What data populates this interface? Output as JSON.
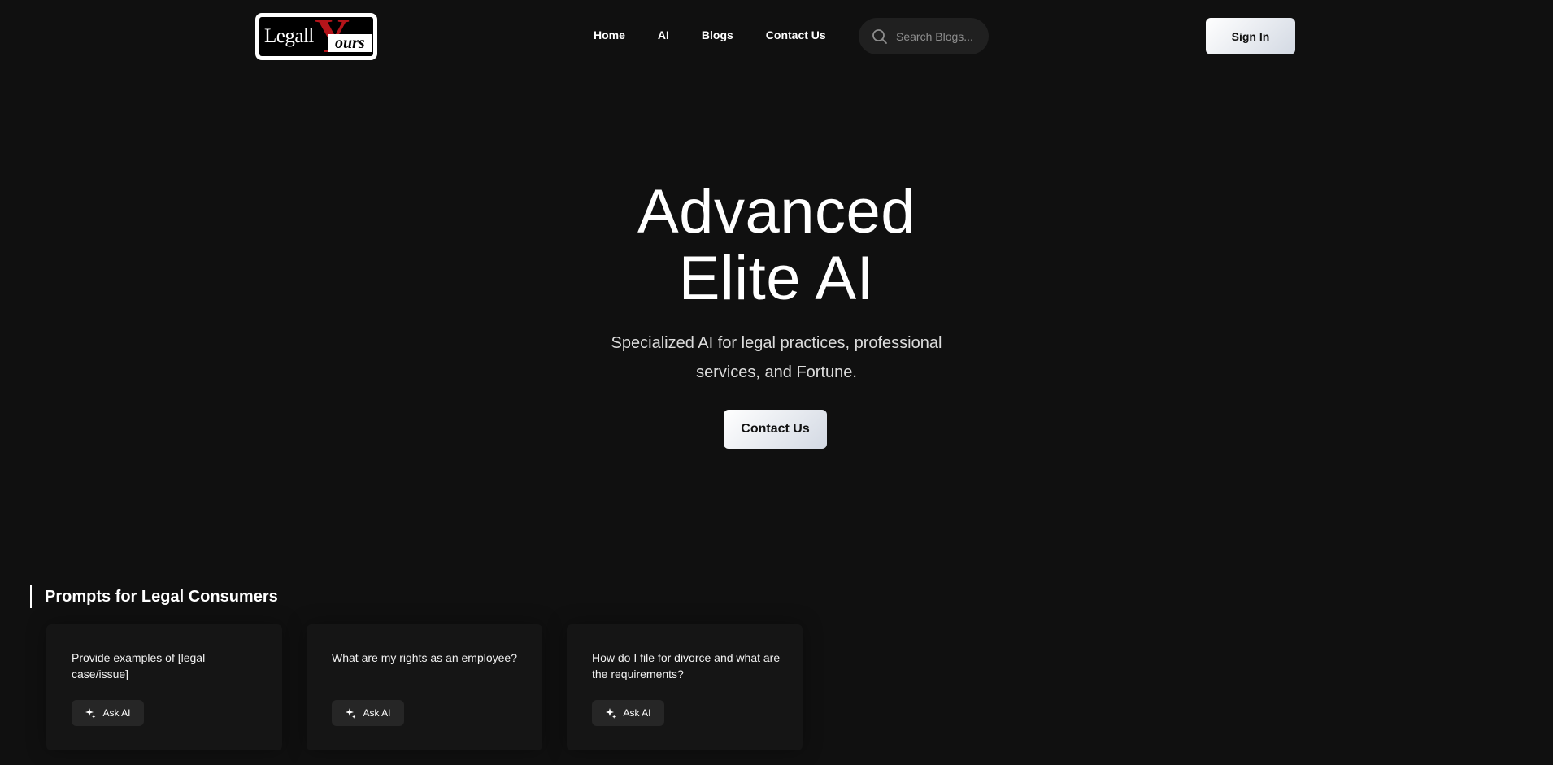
{
  "brand": {
    "logo_text_legall": "Legall",
    "logo_text_y": "Y",
    "logo_text_ours": "ours",
    "logo_red": "#b4141a"
  },
  "nav": {
    "items": [
      {
        "label": "Home"
      },
      {
        "label": "AI"
      },
      {
        "label": "Blogs"
      },
      {
        "label": "Contact Us"
      }
    ]
  },
  "search": {
    "placeholder": "Search Blogs...",
    "icon": "search-icon"
  },
  "header": {
    "signin_label": "Sign In"
  },
  "hero": {
    "title_line1": "Advanced",
    "title_line2": "Elite AI",
    "subtitle": "Specialized AI for legal practices, professional services, and Fortune.",
    "cta_label": "Contact Us"
  },
  "prompts": {
    "section_title": "Prompts for Legal Consumers",
    "cards": [
      {
        "text": "Provide examples of [legal case/issue]",
        "button_label": "Ask AI",
        "icon": "sparkle-icon"
      },
      {
        "text": "What are my rights as an employee?",
        "button_label": "Ask AI",
        "icon": "sparkle-icon"
      },
      {
        "text": "How do I file for divorce and what are the requirements?",
        "button_label": "Ask AI",
        "icon": "sparkle-icon"
      }
    ]
  },
  "colors": {
    "background": "#101010",
    "card": "#151515",
    "button_gradient_start": "#ffffff",
    "button_gradient_end": "#d3d9e3"
  }
}
